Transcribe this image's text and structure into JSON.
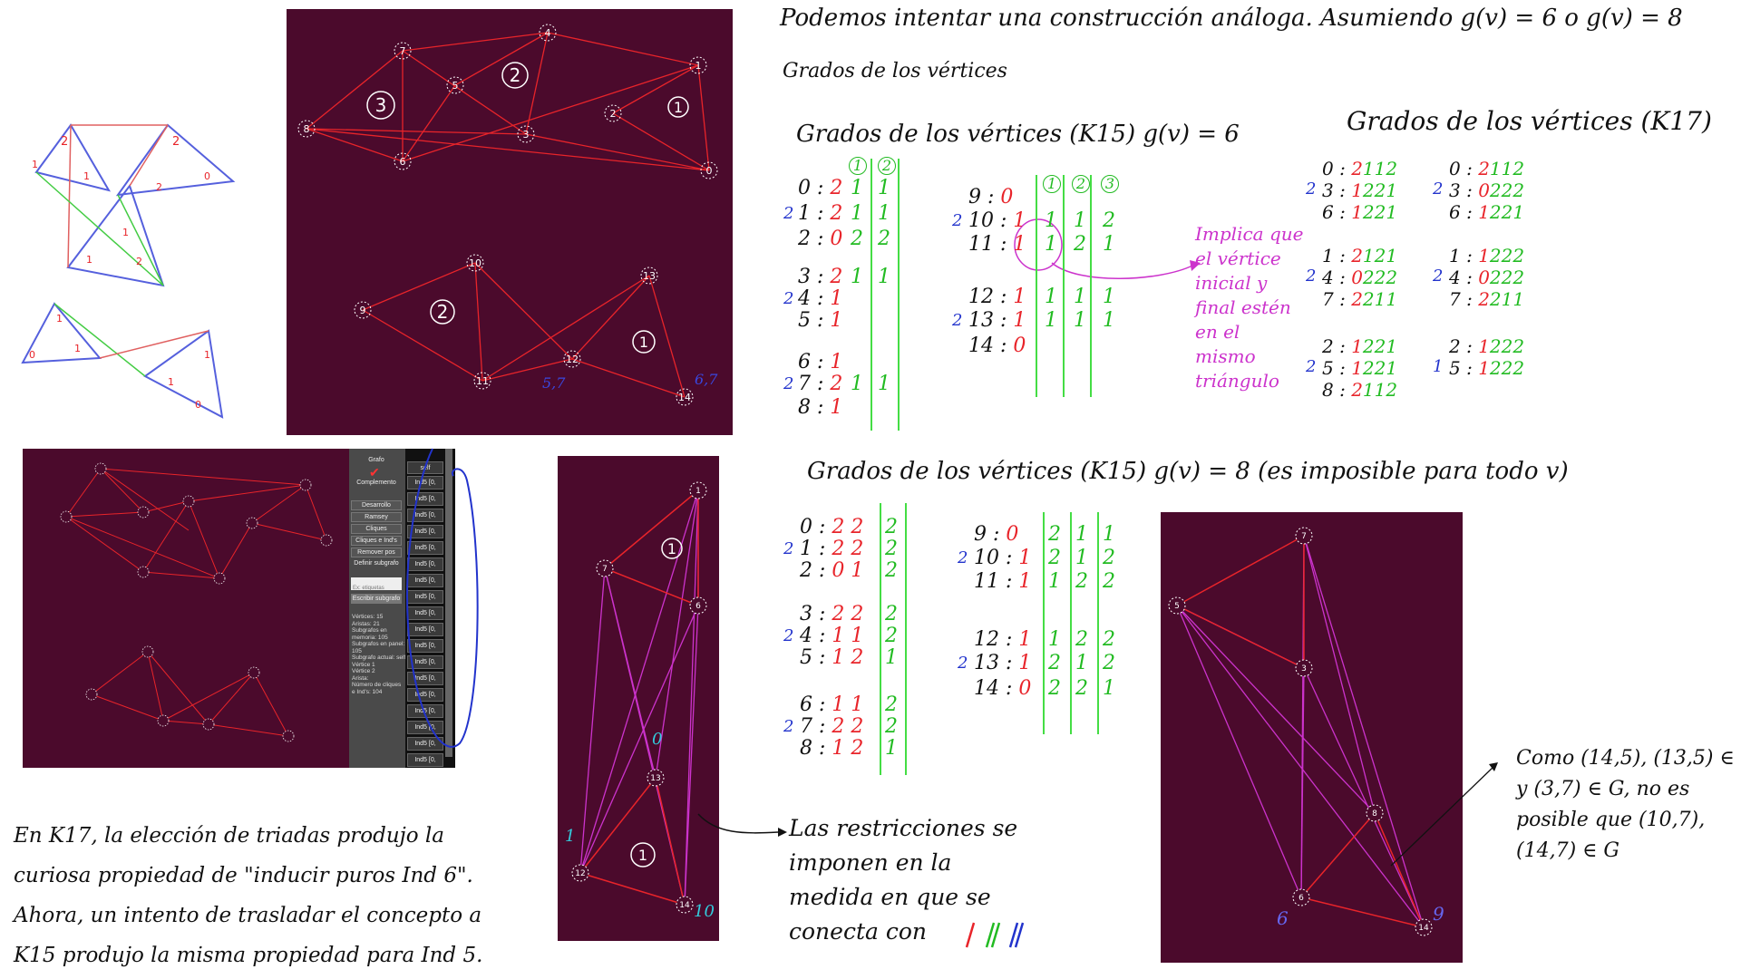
{
  "notes": {
    "intro_line1": "Podemos intentar una construcción análoga. Asumiendo g(v) = 6 o g(v) = 8",
    "intro_line2": "Grados de los vértices",
    "k15_g6_title": "Grados de los vértices (K15) g(v) = 6",
    "k17_title": "Grados de los vértices (K17)",
    "k15_g8_title": "Grados de los vértices (K15) g(v) = 8 (es imposible para todo v)",
    "pink_note": [
      "Implica que",
      "el vértice",
      "inicial y",
      "final estén",
      "en el",
      "mismo",
      "triángulo"
    ],
    "restrictions_note": [
      "Las restricciones se",
      "imponen en la",
      "medida en que se",
      "conecta con"
    ],
    "como_note": [
      "Como (14,5), (13,5) ∈ G",
      "y (3,7) ∈ G, no es",
      "posible que (10,7),",
      "(14,7) ∈ G"
    ],
    "bottom_note": [
      "En K17, la elección de triadas produjo la",
      "curiosa propiedad de \"inducir puros Ind 6\".",
      "Ahora, un intento de trasladar el concepto a",
      "K15 produjo la misma propiedad para Ind 5."
    ],
    "panel1_labels": {
      "bl": "5,7",
      "br": "6,7"
    },
    "panel3_labels": {
      "zero": "0",
      "one": "1",
      "ten": "10"
    },
    "panel4_labels": {
      "six": "6",
      "nine": "9"
    }
  },
  "panel1": {
    "top_vertices": {
      "v4": "4",
      "v7": "7",
      "v5": "5",
      "v1": "1",
      "v2": "2",
      "v8": "8",
      "v3": "3",
      "v6": "6",
      "v0": "0"
    },
    "top_regions": [
      "3",
      "2",
      "1"
    ],
    "bottom_vertices": {
      "v10": "10",
      "v13": "13",
      "v9": "9",
      "v12": "12",
      "v11": "11",
      "v14": "14"
    },
    "bottom_regions": [
      "2",
      "1"
    ]
  },
  "gui": {
    "sidebar_buttons": [
      "Grafo",
      "Complemento",
      "Desarrollo",
      "Ramsey",
      "Cliques",
      "Cliques e Ind's",
      "Remover pos",
      "Definir subgrafo"
    ],
    "input_placeholder": "Ex: etiquetas",
    "gray_button": "Escribir subgrafo",
    "info_text": "Vértices: 15\nAristas: 21\nSubgrafos en\nmemoria: 105\nSubgrafos en panel:\n105\nSubgrafo actual: self\nVértice 1\nVértice 2\nArista:\nNúmero de cliques\ne Ind's: 104",
    "list_header": "self",
    "list_item": "Ind5 [0,"
  },
  "panel3": {
    "vertices": {
      "v1": "1",
      "v7": "7",
      "v6": "6",
      "v13": "13",
      "v12": "12",
      "v14": "14"
    },
    "regions": [
      "1",
      "1"
    ]
  },
  "panel4": {
    "vertices": {
      "v7": "7",
      "v5": "5",
      "v3": "3",
      "v8": "8",
      "v6": "6",
      "v14": "14"
    }
  },
  "table_k15_g6": {
    "left": {
      "headers": [
        "1",
        "2"
      ],
      "rows": [
        {
          "v": "0",
          "a": "2",
          "b": "1",
          "c": "1"
        },
        {
          "v": "1",
          "a": "2",
          "b": "1",
          "c": "1"
        },
        {
          "v": "2",
          "a": "0",
          "b": "2",
          "c": "2"
        },
        {
          "v": "3",
          "a": "2",
          "b": "1",
          "c": "1"
        },
        {
          "v": "4",
          "a": "1",
          "b": "",
          "c": ""
        },
        {
          "v": "5",
          "a": "1",
          "b": "",
          "c": ""
        },
        {
          "v": "6",
          "a": "1",
          "b": "",
          "c": ""
        },
        {
          "v": "7",
          "a": "2",
          "b": "1",
          "c": "1"
        },
        {
          "v": "8",
          "a": "1",
          "b": "",
          "c": ""
        }
      ],
      "group_marks": [
        "2",
        "2",
        "2"
      ]
    },
    "right": {
      "headers": [
        "1",
        "2",
        "3"
      ],
      "rows": [
        {
          "v": "9",
          "a": "0"
        },
        {
          "v": "10",
          "a": "1",
          "b": "1",
          "c": "1",
          "d": "2"
        },
        {
          "v": "11",
          "a": "1",
          "b": "1",
          "c": "2",
          "d": "1"
        },
        {
          "v": "12",
          "a": "1",
          "b": "1",
          "c": "1",
          "d": "1"
        },
        {
          "v": "13",
          "a": "1",
          "b": "1",
          "c": "1",
          "d": "1"
        },
        {
          "v": "14",
          "a": "0"
        }
      ],
      "group_marks": [
        "2",
        "2"
      ]
    }
  },
  "table_k15_g8": {
    "left": {
      "rows": [
        {
          "v": "0",
          "a": "2",
          "b": "2",
          "c": "2"
        },
        {
          "v": "1",
          "a": "2",
          "b": "2",
          "c": "2"
        },
        {
          "v": "2",
          "a": "0",
          "b": "1",
          "c": "2"
        },
        {
          "v": "3",
          "a": "2",
          "b": "2",
          "c": "2"
        },
        {
          "v": "4",
          "a": "1",
          "b": "1",
          "c": "2"
        },
        {
          "v": "5",
          "a": "1",
          "b": "2",
          "c": "1"
        },
        {
          "v": "6",
          "a": "1",
          "b": "1",
          "c": "2"
        },
        {
          "v": "7",
          "a": "2",
          "b": "2",
          "c": "2"
        },
        {
          "v": "8",
          "a": "1",
          "b": "2",
          "c": "1"
        }
      ]
    },
    "right": {
      "rows": [
        {
          "v": "9",
          "a": "0",
          "b": "2",
          "c": "1",
          "d": "1"
        },
        {
          "v": "10",
          "a": "1",
          "b": "2",
          "c": "1",
          "d": "2"
        },
        {
          "v": "11",
          "a": "1",
          "b": "1",
          "c": "2",
          "d": "2"
        },
        {
          "v": "12",
          "a": "1",
          "b": "1",
          "c": "2",
          "d": "2"
        },
        {
          "v": "13",
          "a": "1",
          "b": "2",
          "c": "1",
          "d": "2"
        },
        {
          "v": "14",
          "a": "0",
          "b": "2",
          "c": "2",
          "d": "1"
        }
      ]
    }
  },
  "table_k17": {
    "blocks": [
      {
        "rows": [
          [
            "0",
            "2112"
          ],
          [
            "3",
            "1221"
          ],
          [
            "6",
            "1221"
          ]
        ],
        "mark": "2"
      },
      {
        "rows": [
          [
            "0",
            "2112"
          ],
          [
            "3",
            "0222"
          ],
          [
            "6",
            "1221"
          ]
        ],
        "mark": "2"
      },
      {
        "rows": [
          [
            "1",
            "2121"
          ],
          [
            "4",
            "0222"
          ],
          [
            "7",
            "2211"
          ]
        ],
        "mark": "2"
      },
      {
        "rows": [
          [
            "1",
            "1222"
          ],
          [
            "4",
            "0222"
          ],
          [
            "7",
            "2211"
          ]
        ],
        "mark": "2"
      },
      {
        "rows": [
          [
            "2",
            "1221"
          ],
          [
            "5",
            "1221"
          ],
          [
            "8",
            "2112"
          ]
        ],
        "mark": "2"
      },
      {
        "rows": [
          [
            "2",
            "1222"
          ],
          [
            "5",
            "1222"
          ]
        ],
        "mark": "1"
      }
    ]
  }
}
